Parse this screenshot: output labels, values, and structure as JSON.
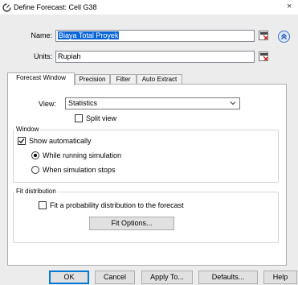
{
  "window": {
    "title": "Define Forecast: Cell G38",
    "close_glyph": "×"
  },
  "fields": {
    "name_label": "Name:",
    "name_value": "Biaya Total Proyek",
    "units_label": "Units:",
    "units_value": "Rupiah"
  },
  "tabs": [
    {
      "label": "Forecast Window",
      "active": true
    },
    {
      "label": "Precision",
      "active": false
    },
    {
      "label": "Filter",
      "active": false
    },
    {
      "label": "Auto Extract",
      "active": false
    }
  ],
  "view": {
    "label": "View:",
    "selected": "Statistics",
    "split_view_label": "Split view",
    "split_view_checked": false
  },
  "window_group": {
    "title": "Window",
    "show_auto_label": "Show automatically",
    "show_auto_checked": true,
    "radio_running_label": "While running simulation",
    "radio_stops_label": "When simulation stops",
    "selected_option": "While running simulation"
  },
  "fit_group": {
    "title": "Fit distribution",
    "fit_label": "Fit a probability distribution to the forecast",
    "fit_checked": false,
    "options_button": "Fit Options..."
  },
  "footer": {
    "ok": "OK",
    "cancel": "Cancel",
    "apply": "Apply To...",
    "defaults": "Defaults...",
    "help": "Help"
  },
  "colors": {
    "selection": "#0a64d8",
    "dialog_bg": "#ececec",
    "accent": "#0078d7",
    "collapse_icon": "#3b6fc4"
  },
  "icons": {
    "app": "forecast-app-icon",
    "cell_reference": "cell-reference-icon",
    "collapse": "double-chevron-up-icon",
    "dropdown": "chevron-down-icon",
    "checkmark": "checkmark-icon"
  }
}
